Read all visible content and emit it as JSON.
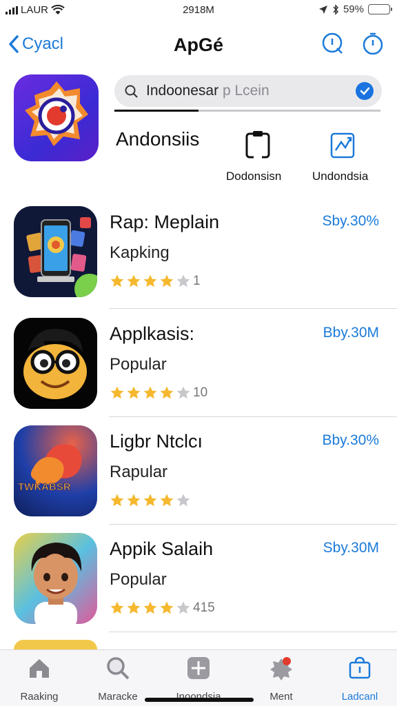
{
  "status_bar": {
    "carrier": "LAUR",
    "time": "2918M",
    "battery": "59%",
    "battery_level": 0.9
  },
  "nav": {
    "back_label": "Cyacl",
    "title": "ApGé"
  },
  "search": {
    "query": "Indoonesar",
    "placeholder": "p Lcein"
  },
  "header": {
    "category_label": "Andonsiis",
    "shortcuts": [
      {
        "label": "Dodonsisn",
        "icon": "clipboard-icon"
      },
      {
        "label": "Undondsia",
        "icon": "chart-icon"
      }
    ]
  },
  "apps": [
    {
      "name": "Rap: Meplain",
      "subtitle": "Kapking",
      "rating": 4,
      "rating_count": "1",
      "size": "Sby.30%",
      "icon": "phone-game-icon"
    },
    {
      "name": "Applkasis:",
      "subtitle": "Popular",
      "rating": 4,
      "rating_count": "10",
      "size": "Bby.30M",
      "icon": "glasses-emoji-icon"
    },
    {
      "name": "Ligbr Ntclcı",
      "subtitle": "Rapular",
      "rating": 4,
      "rating_count": "",
      "size": "Bby.30%",
      "icon": "chat-bubble-app-icon",
      "icon_text": "TWKABSR"
    },
    {
      "name": "Appik Salaih",
      "subtitle": "Popular",
      "rating": 4,
      "rating_count": "415",
      "size": "Sby.30M",
      "icon": "cartoon-boy-icon"
    }
  ],
  "tabs": [
    {
      "label": "Raaking",
      "icon": "home-icon"
    },
    {
      "label": "Maracke",
      "icon": "search-icon"
    },
    {
      "label": "Inoondsia",
      "icon": "plus-box-icon"
    },
    {
      "label": "Ment",
      "icon": "badge-icon"
    },
    {
      "label": "Ladcanl",
      "icon": "bag-icon"
    }
  ],
  "colors": {
    "accent": "#1a7ad9",
    "star": "#f5b82e",
    "star_empty": "#c8c8cc"
  }
}
